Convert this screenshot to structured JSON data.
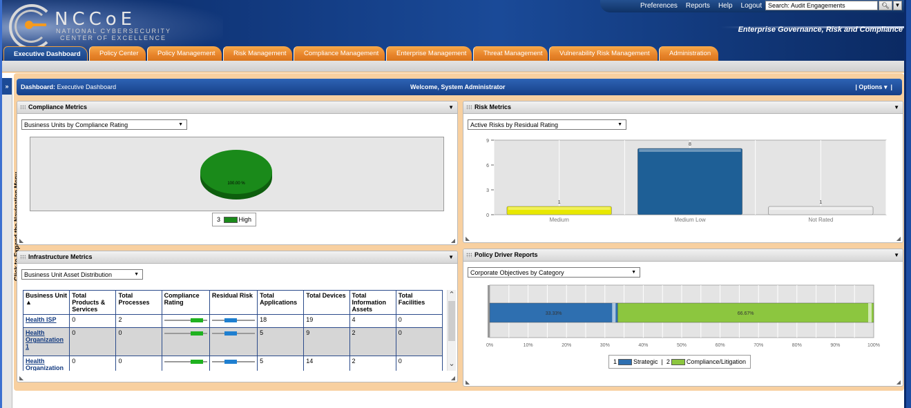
{
  "header": {
    "logo_main": "NCCoE",
    "logo_sub1": "NATIONAL CYBERSECURITY",
    "logo_sub2": "CENTER OF EXCELLENCE",
    "links": [
      "Preferences",
      "Reports",
      "Help",
      "Logout"
    ],
    "search_placeholder": "Search: Audit Engagements",
    "slogan": "Enterprise Governance, Risk and Compliance"
  },
  "tabs": [
    "Executive Dashboard",
    "Policy Center",
    "Policy Management",
    "Risk Management",
    "Compliance Management",
    "Enterprise Management",
    "Threat Management",
    "Vulnerability Risk Management",
    "Administration"
  ],
  "active_tab": "Executive Dashboard",
  "sidebar": {
    "expand_label": "Click to Expand the Navigation Menu",
    "chevron": "»"
  },
  "dashboard": {
    "label": "Dashboard:",
    "name": "Executive Dashboard",
    "welcome": "Welcome, System Administrator",
    "options": "Options"
  },
  "compliance": {
    "title": "Compliance Metrics",
    "select": "Business Units by Compliance Rating",
    "legend_count": "3",
    "legend_label": "High",
    "color": "#1a8a1a"
  },
  "risk": {
    "title": "Risk Metrics",
    "select": "Active Risks by Residual Rating"
  },
  "infra": {
    "title": "Infrastructure Metrics",
    "select": "Business Unit Asset Distribution",
    "columns": [
      "Business Unit",
      "Total Products & Services",
      "Total Processes",
      "Compliance Rating",
      "Residual Risk",
      "Total Applications",
      "Total Devices",
      "Total Information Assets",
      "Total Facilities"
    ],
    "sort_indicator": "▲",
    "rows": [
      {
        "unit": "Health ISP",
        "products": "0",
        "processes": "2",
        "apps": "18",
        "devices": "19",
        "info": "4",
        "facilities": "0"
      },
      {
        "unit": "Health Organization 1",
        "products": "0",
        "processes": "0",
        "apps": "5",
        "devices": "9",
        "info": "2",
        "facilities": "0"
      },
      {
        "unit": "Health Organization",
        "products": "0",
        "processes": "0",
        "apps": "5",
        "devices": "14",
        "info": "2",
        "facilities": "0"
      }
    ]
  },
  "policy": {
    "title": "Policy Driver Reports",
    "select": "Corporate Objectives by Category",
    "legend": [
      {
        "num": "1",
        "label": "Strategic",
        "color": "#2e6fb0"
      },
      {
        "num": "2",
        "label": "Compliance/Litigation",
        "color": "#8cc63f"
      }
    ]
  },
  "chart_data": [
    {
      "type": "pie",
      "categories": [
        "High"
      ],
      "values": [
        100.0
      ],
      "data_labels": [
        "100.00 %"
      ],
      "colors": [
        "#1a8a1a"
      ]
    },
    {
      "type": "bar",
      "categories": [
        "Medium",
        "Medium Low",
        "Not Rated"
      ],
      "values": [
        1,
        8,
        1
      ],
      "ylim": [
        0,
        9
      ],
      "yticks": [
        0,
        3,
        6,
        9
      ],
      "colors": [
        "#e8e800",
        "#1e5f96",
        "#e6e6e6"
      ],
      "grid": true
    },
    {
      "type": "bar",
      "orientation": "horizontal-stacked",
      "series": [
        {
          "name": "Strategic",
          "values": [
            33.33
          ]
        },
        {
          "name": "Compliance/Litigation",
          "values": [
            66.67
          ]
        }
      ],
      "data_labels": [
        "33.33%",
        "66.67%"
      ],
      "xticks": [
        "0%",
        "10%",
        "20%",
        "30%",
        "40%",
        "50%",
        "60%",
        "70%",
        "80%",
        "90%",
        "100%"
      ],
      "xlim": [
        0,
        100
      ],
      "legend_position": "bottom"
    }
  ]
}
